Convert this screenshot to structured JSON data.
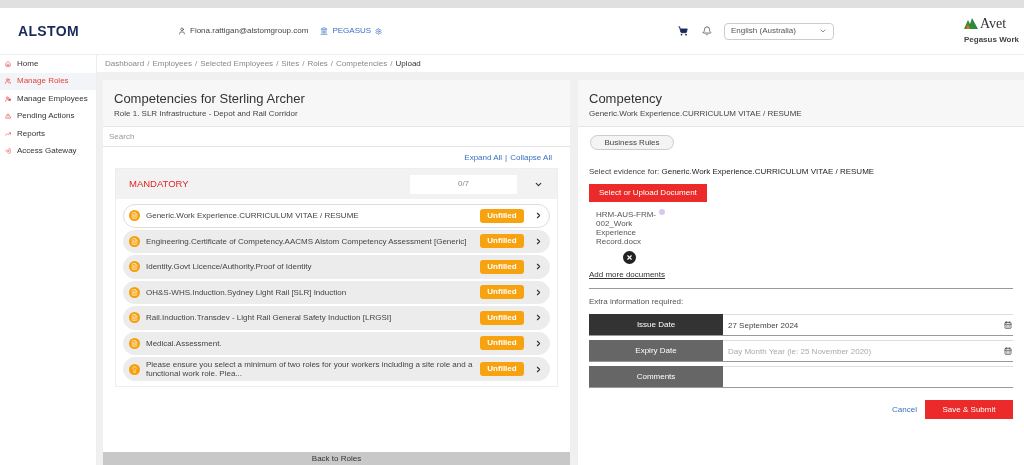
{
  "header": {
    "logo": "ALSTOM",
    "user": "Fiona.rattigan@alstomgroup.com",
    "org": "PEGASUS",
    "language": "English (Australia)",
    "brand": "Avet",
    "brand_subtitle": "Pegasus Work"
  },
  "sidebar": {
    "items": [
      {
        "label": "Home",
        "selected": false
      },
      {
        "label": "Manage Roles",
        "selected": true
      },
      {
        "label": "Manage Employees",
        "selected": false
      },
      {
        "label": "Pending Actions",
        "selected": false
      },
      {
        "label": "Reports",
        "selected": false
      },
      {
        "label": "Access Gateway",
        "selected": false
      }
    ]
  },
  "breadcrumb": {
    "separator": "/",
    "items": [
      "Dashboard",
      "Employees",
      "Selected Employees",
      "Sites",
      "Roles",
      "Competencies",
      "Upload"
    ]
  },
  "competencies": {
    "title": "Competencies for Sterling Archer",
    "subtitle": "Role 1. SLR Infrastructure - Depot and Rail Corridor",
    "search_placeholder": "Search",
    "expand_all": "Expand All",
    "link_separator": "|",
    "collapse_all": "Collapse All",
    "group": {
      "title": "MANDATORY",
      "count": "0/7",
      "expanded": true,
      "items": [
        {
          "label": "Generic.Work Experience.CURRICULUM VITAE / RESUME",
          "status": "Unfilled",
          "selected": true,
          "kind": "document"
        },
        {
          "label": "Engineering.Certificate of Competency.AACMS Alstom Competency Assessment [Generic]",
          "status": "Unfilled",
          "selected": false,
          "kind": "document"
        },
        {
          "label": "Identity.Govt Licence/Authority.Proof of Identity",
          "status": "Unfilled",
          "selected": false,
          "kind": "document"
        },
        {
          "label": "OH&S-WHS.Induction.Sydney Light Rail [SLR] Induction",
          "status": "Unfilled",
          "selected": false,
          "kind": "document"
        },
        {
          "label": "Rail.Induction.Transdev - Light Rail General Safety Induction [LRGSI]",
          "status": "Unfilled",
          "selected": false,
          "kind": "document"
        },
        {
          "label": "Medical.Assessment.",
          "status": "Unfilled",
          "selected": false,
          "kind": "document"
        },
        {
          "label": "Please ensure you select a minimum of two roles for your workers including a site role and a functional work role. Plea...",
          "status": "Unfilled",
          "selected": false,
          "kind": "question"
        }
      ]
    },
    "back_button": "Back to Roles"
  },
  "competency": {
    "title": "Competency",
    "subtitle": "Generic.Work Experience.CURRICULUM VITAE / RESUME",
    "business_rules": "Business Rules",
    "evidence_label": "Select evidence for:",
    "evidence_name": "Generic.Work Experience.CURRICULUM VITAE / RESUME",
    "upload_button": "Select or Upload Document",
    "file_name": "HRM-AUS-FRM-002_Work Experience Record.docx",
    "add_more": "Add more documents",
    "extra_info": "Extra information required:",
    "fields": [
      {
        "label": "Issue Date",
        "value": "27 September 2024",
        "focused": true,
        "kind": "date"
      },
      {
        "label": "Expiry Date",
        "placeholder": "Day Month Year (ie: 25 November 2020)",
        "focused": false,
        "kind": "date"
      },
      {
        "label": "Comments",
        "focused": false,
        "kind": "text"
      }
    ],
    "cancel": "Cancel",
    "submit": "Save & Submit"
  }
}
